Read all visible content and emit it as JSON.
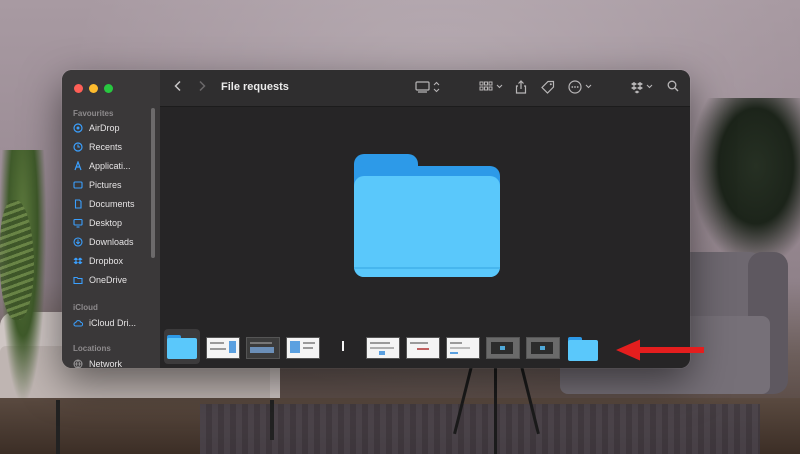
{
  "window": {
    "title": "File requests"
  },
  "sidebar": {
    "sections": [
      {
        "label": "Favourites"
      },
      {
        "label": "iCloud"
      },
      {
        "label": "Locations"
      }
    ],
    "favourites": [
      {
        "label": "AirDrop",
        "icon": "airdrop-icon"
      },
      {
        "label": "Recents",
        "icon": "clock-icon"
      },
      {
        "label": "Applicati...",
        "icon": "applications-icon"
      },
      {
        "label": "Pictures",
        "icon": "pictures-icon"
      },
      {
        "label": "Documents",
        "icon": "documents-icon"
      },
      {
        "label": "Desktop",
        "icon": "desktop-icon"
      },
      {
        "label": "Downloads",
        "icon": "downloads-icon"
      },
      {
        "label": "Dropbox",
        "icon": "dropbox-icon"
      },
      {
        "label": "OneDrive",
        "icon": "folder-icon"
      }
    ],
    "icloud": [
      {
        "label": "iCloud Dri...",
        "icon": "cloud-icon"
      }
    ],
    "locations": [
      {
        "label": "Network",
        "icon": "network-icon"
      }
    ]
  },
  "toolbar": {
    "back_icon": "chevron-left-icon",
    "forward_icon": "chevron-right-icon",
    "view_icon": "gallery-view-icon",
    "group_icon": "grid-icon",
    "share_icon": "share-icon",
    "tag_icon": "tag-icon",
    "more_icon": "ellipsis-icon",
    "dropbox_icon": "dropbox-icon",
    "search_icon": "search-icon"
  },
  "filmstrip": {
    "items": [
      {
        "kind": "folder",
        "selected": true
      },
      {
        "kind": "document"
      },
      {
        "kind": "screenshot-dark"
      },
      {
        "kind": "document"
      },
      {
        "kind": "thin"
      },
      {
        "kind": "document"
      },
      {
        "kind": "document"
      },
      {
        "kind": "document"
      },
      {
        "kind": "photo-dark"
      },
      {
        "kind": "photo-dark"
      },
      {
        "kind": "folder",
        "selected": false
      }
    ]
  },
  "colors": {
    "folder_front": "#5ac8fb",
    "folder_back": "#2d9ae8",
    "annotation_arrow": "#e41e1e",
    "window_bg": "#262526",
    "sidebar_bg": "#3a3839"
  }
}
